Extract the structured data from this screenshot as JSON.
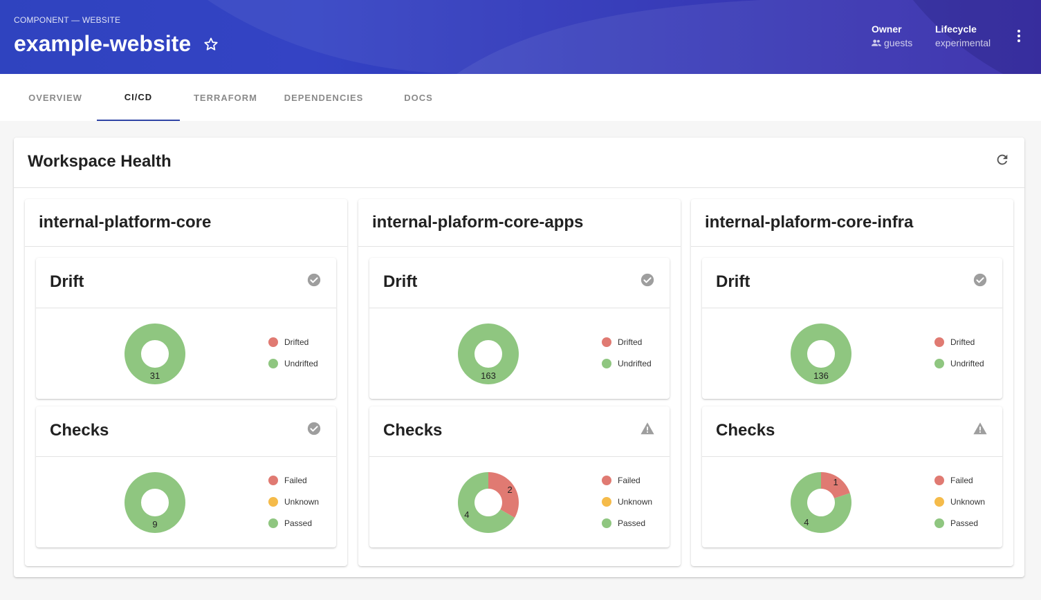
{
  "header": {
    "breadcrumb": "COMPONENT — WEBSITE",
    "title": "example-website",
    "owner_label": "Owner",
    "owner_value": "guests",
    "lifecycle_label": "Lifecycle",
    "lifecycle_value": "experimental"
  },
  "tabs": [
    {
      "label": "OVERVIEW",
      "active": false
    },
    {
      "label": "CI/CD",
      "active": true
    },
    {
      "label": "TERRAFORM",
      "active": false
    },
    {
      "label": "DEPENDENCIES",
      "active": false
    },
    {
      "label": "DOCS",
      "active": false
    }
  ],
  "main": {
    "title": "Workspace Health",
    "workspaces": [
      {
        "name": "internal-platform-core",
        "drift": {
          "title": "Drift",
          "status_icon": "check-circle-icon",
          "legend": [
            "Drifted",
            "Undrifted"
          ],
          "drifted": 0,
          "undrifted": 31,
          "undrifted_label": "31"
        },
        "checks": {
          "title": "Checks",
          "status_icon": "check-circle-icon",
          "legend": [
            "Failed",
            "Unknown",
            "Passed"
          ],
          "failed": 0,
          "unknown": 0,
          "passed": 9,
          "failed_label": "",
          "passed_label": "9"
        }
      },
      {
        "name": "internal-plaform-core-apps",
        "drift": {
          "title": "Drift",
          "status_icon": "check-circle-icon",
          "legend": [
            "Drifted",
            "Undrifted"
          ],
          "drifted": 0,
          "undrifted": 163,
          "undrifted_label": "163"
        },
        "checks": {
          "title": "Checks",
          "status_icon": "warning-icon",
          "legend": [
            "Failed",
            "Unknown",
            "Passed"
          ],
          "failed": 2,
          "unknown": 0,
          "passed": 4,
          "failed_label": "2",
          "passed_label": "4"
        }
      },
      {
        "name": "internal-plaform-core-infra",
        "drift": {
          "title": "Drift",
          "status_icon": "check-circle-icon",
          "legend": [
            "Drifted",
            "Undrifted"
          ],
          "drifted": 0,
          "undrifted": 136,
          "undrifted_label": "136"
        },
        "checks": {
          "title": "Checks",
          "status_icon": "warning-icon",
          "legend": [
            "Failed",
            "Unknown",
            "Passed"
          ],
          "failed": 1,
          "unknown": 0,
          "passed": 4,
          "failed_label": "1",
          "passed_label": "4"
        }
      }
    ]
  },
  "colors": {
    "failed": "#e07a72",
    "unknown": "#f5bb4a",
    "passed": "#8fc680",
    "header_start": "#2f43bf",
    "header_end": "#271aa3",
    "tab_indicator": "#2f43a4"
  }
}
